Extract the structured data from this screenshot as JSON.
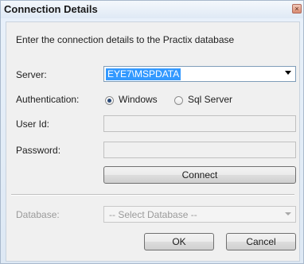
{
  "window": {
    "title": "Connection Details",
    "close_glyph": "×"
  },
  "intro_text": "Enter the connection details to the Practix database",
  "server": {
    "label": "Server:",
    "value": "EYE7\\MSPDATA"
  },
  "authentication": {
    "label": "Authentication:",
    "options": [
      {
        "label": "Windows",
        "checked": true
      },
      {
        "label": "Sql Server",
        "checked": false
      }
    ]
  },
  "user_id": {
    "label": "User Id:",
    "value": ""
  },
  "password": {
    "label": "Password:",
    "value": ""
  },
  "connect_label": "Connect",
  "database": {
    "label": "Database:",
    "placeholder": "-- Select Database --"
  },
  "buttons": {
    "ok": "OK",
    "cancel": "Cancel"
  },
  "icons": {
    "close": "close-icon",
    "dropdown": "chevron-down-icon"
  }
}
